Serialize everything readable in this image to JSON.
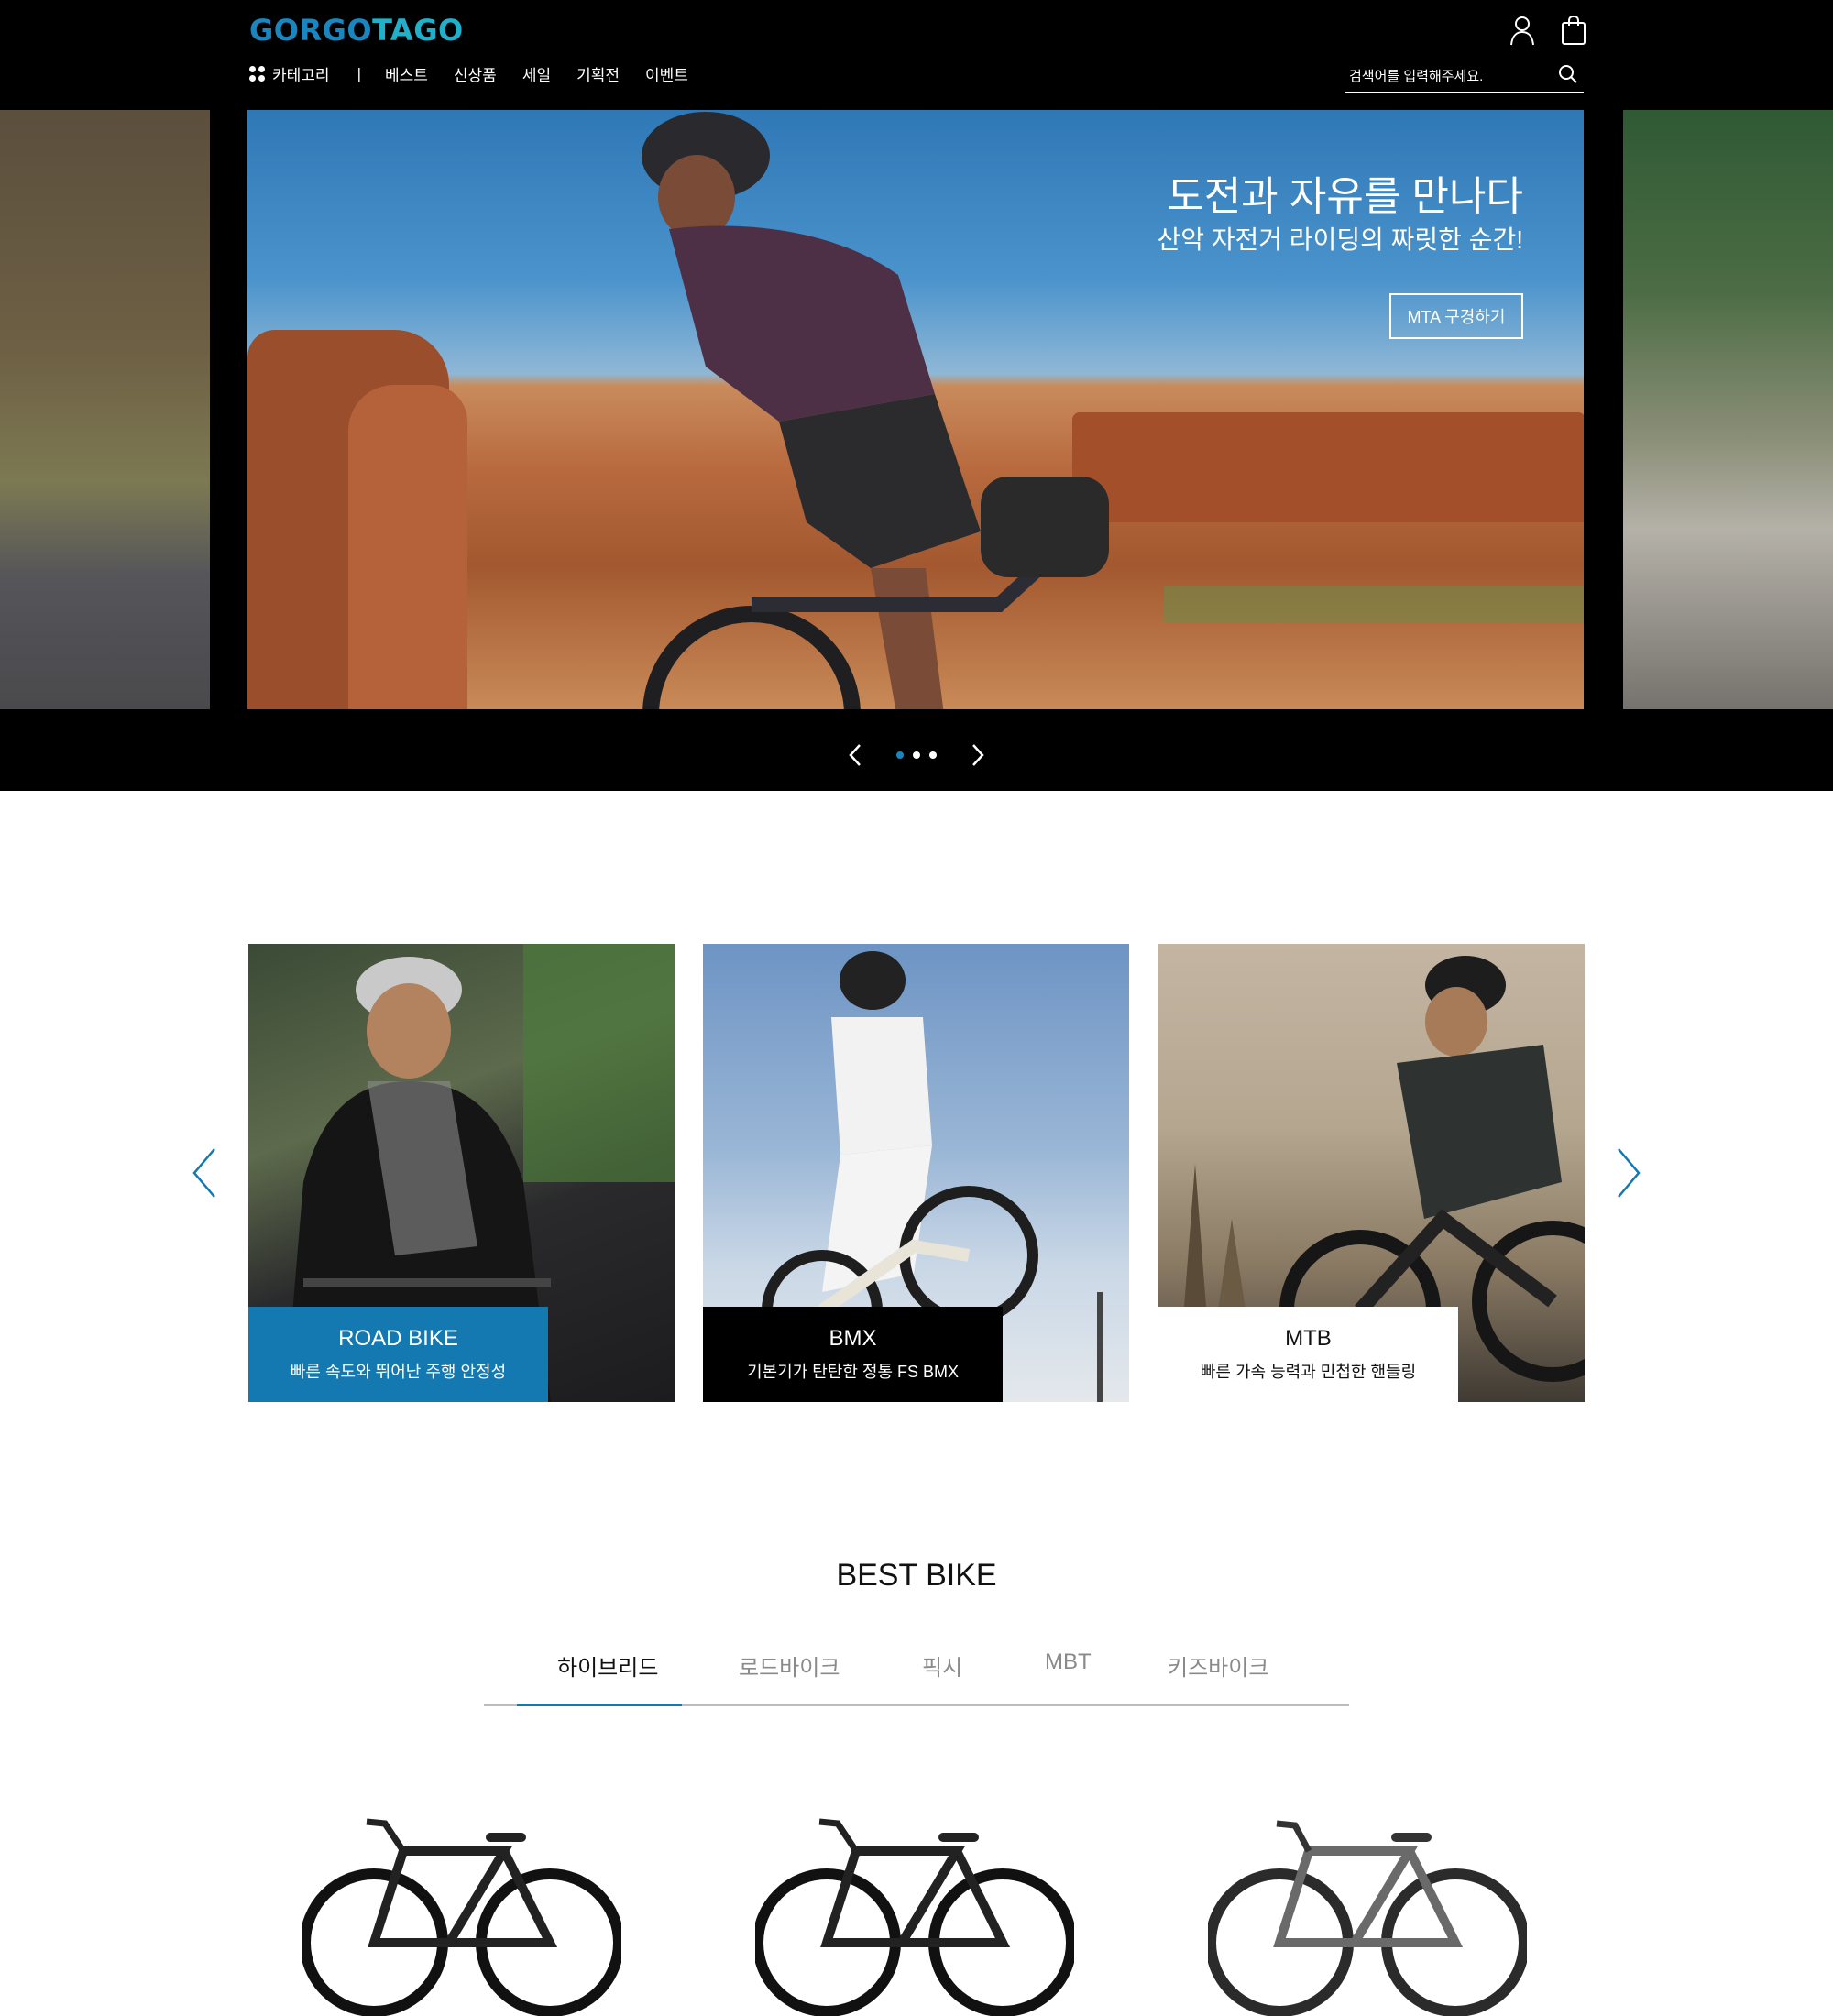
{
  "header": {
    "logo_part1": "GORGO",
    "logo_part2": "TAGO",
    "nav": {
      "category": "카테고리",
      "separator": "|",
      "items": [
        "베스트",
        "신상품",
        "세일",
        "기획전",
        "이벤트"
      ]
    },
    "search": {
      "placeholder": "검색어를 입력해주세요."
    },
    "icons": [
      "user-icon",
      "shopping-bag-icon",
      "search-icon"
    ]
  },
  "hero": {
    "title": "도전과 자유를 만나다",
    "subtitle": "산악 자전거 라이딩의 짜릿한 순간!",
    "button": "MTA 구경하기",
    "slide_count": 3,
    "active_slide": 1
  },
  "categories": [
    {
      "title": "ROAD BIKE",
      "subtitle": "빠른 속도와 뛰어난 주행 안정성"
    },
    {
      "title": "BMX",
      "subtitle": "기본기가 탄탄한 정통 FS BMX"
    },
    {
      "title": "MTB",
      "subtitle": "빠른 가속 능력과 민첩한 핸들링"
    }
  ],
  "best": {
    "title": "BEST BIKE",
    "tabs": [
      "하이브리드",
      "로드바이크",
      "픽시",
      "MBT",
      "키즈바이크"
    ],
    "active_tab": 0
  },
  "colors": {
    "accent": "#1579b1",
    "logo_blue": "#1a86c0",
    "logo_teal": "#21b0c9",
    "header_bg": "#000000"
  }
}
